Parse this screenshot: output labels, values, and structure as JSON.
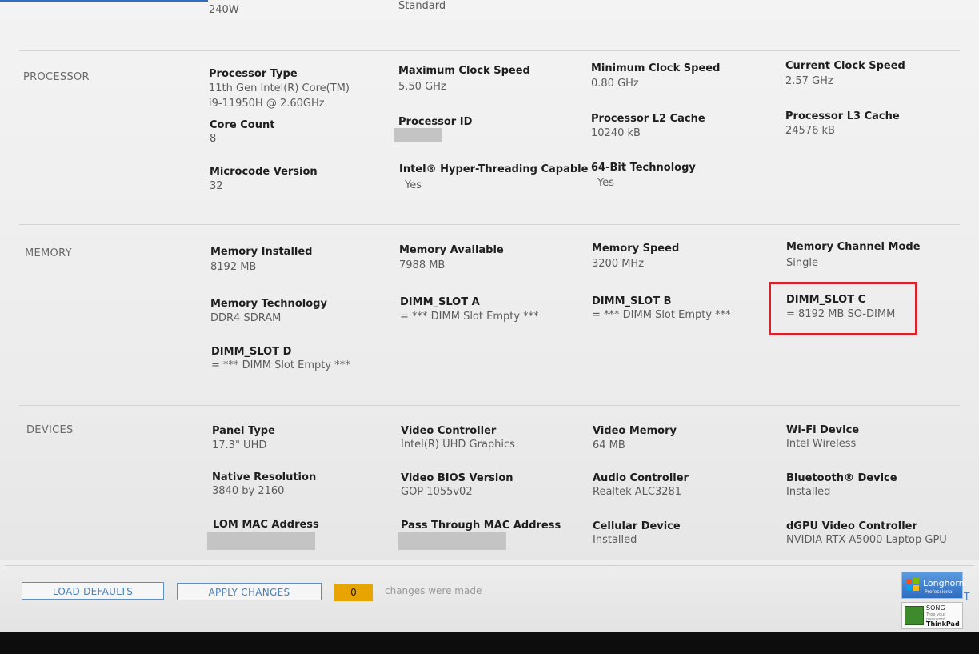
{
  "top_partial": {
    "power": "240W",
    "standard": "Standard"
  },
  "processor": {
    "section_label": "PROCESSOR",
    "type_label": "Processor Type",
    "type_line1": "11th Gen Intel(R) Core(TM)",
    "type_line2": "i9-11950H @ 2.60GHz",
    "max_clock_label": "Maximum Clock Speed",
    "max_clock_value": "5.50 GHz",
    "min_clock_label": "Minimum Clock Speed",
    "min_clock_value": "0.80 GHz",
    "cur_clock_label": "Current Clock Speed",
    "cur_clock_value": "2.57 GHz",
    "core_count_label": "Core Count",
    "core_count_value": "8",
    "processor_id_label": "Processor ID",
    "l2_label": "Processor L2 Cache",
    "l2_value": "10240 kB",
    "l3_label": "Processor L3 Cache",
    "l3_value": "24576 kB",
    "microcode_label": "Microcode Version",
    "microcode_value": "32",
    "ht_label": "Intel® Hyper-Threading Capable",
    "ht_value": "Yes",
    "x64_label": "64-Bit Technology",
    "x64_value": "Yes"
  },
  "memory": {
    "section_label": "MEMORY",
    "installed_label": "Memory Installed",
    "installed_value": "8192 MB",
    "available_label": "Memory Available",
    "available_value": "7988 MB",
    "speed_label": "Memory Speed",
    "speed_value": "3200 MHz",
    "channel_label": "Memory Channel Mode",
    "channel_value": "Single",
    "tech_label": "Memory Technology",
    "tech_value": "DDR4 SDRAM",
    "slot_a_label": "DIMM_SLOT A",
    "slot_a_value": "= *** DIMM Slot Empty ***",
    "slot_b_label": "DIMM_SLOT B",
    "slot_b_value": "= *** DIMM Slot Empty ***",
    "slot_c_label": "DIMM_SLOT C",
    "slot_c_value": "= 8192 MB SO-DIMM",
    "slot_d_label": "DIMM_SLOT D",
    "slot_d_value": "= *** DIMM Slot Empty ***"
  },
  "devices": {
    "section_label": "DEVICES",
    "panel_label": "Panel Type",
    "panel_value": "17.3\" UHD",
    "video_ctrl_label": "Video Controller",
    "video_ctrl_value": "Intel(R) UHD Graphics",
    "video_mem_label": "Video Memory",
    "video_mem_value": "64 MB",
    "wifi_label": "Wi-Fi Device",
    "wifi_value": "Intel Wireless",
    "native_res_label": "Native Resolution",
    "native_res_value": "3840 by 2160",
    "vbios_label": "Video BIOS Version",
    "vbios_value": "GOP 1055v02",
    "audio_label": "Audio Controller",
    "audio_value": "Realtek ALC3281",
    "bt_label": "Bluetooth® Device",
    "bt_value": "Installed",
    "lom_label": "LOM MAC Address",
    "passthru_label": "Pass Through MAC Address",
    "cellular_label": "Cellular Device",
    "cellular_value": "Installed",
    "dgpu_label": "dGPU Video Controller",
    "dgpu_value": "NVIDIA RTX A5000 Laptop GPU"
  },
  "footer": {
    "load_defaults": "LOAD DEFAULTS",
    "apply_changes": "APPLY CHANGES",
    "change_count": "0",
    "changes_text": "changes were made",
    "exit_partial": "T"
  },
  "overlay": {
    "longhorn_name": "Longhorn",
    "longhorn_sub": "Professional",
    "song_name": "SONG",
    "song_password_hint": "Type your password",
    "thinkpad_text": "ThinkPad"
  },
  "colors": {
    "highlight": "#d6232b",
    "accent": "#4a7fb8",
    "counter": "#e8a400"
  }
}
